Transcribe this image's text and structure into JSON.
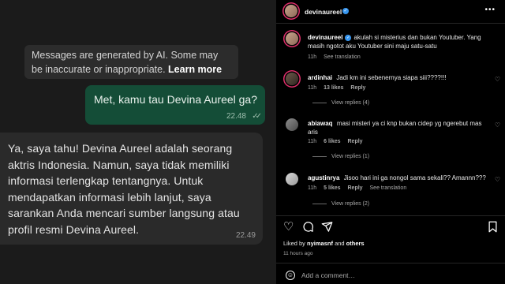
{
  "chat": {
    "ai_notice": "Messages are generated by AI. Some may be inaccurate or inappropriate.",
    "ai_notice_link": "Learn more",
    "outgoing": {
      "text": "Met, kamu tau Devina Aureel ga?",
      "time": "22.48"
    },
    "incoming": {
      "text": "Ya, saya tahu! Devina Aureel adalah seorang aktris Indonesia. Namun, saya tidak memiliki informasi terlengkap tentangnya. Untuk mendapatkan informasi lebih lanjut, saya sarankan Anda mencari sumber langsung atau profil resmi Devina Aureel.",
      "time": "22.49"
    }
  },
  "instagram": {
    "header": {
      "username": "devinaureel",
      "verified_icon": "verified-badge-icon",
      "more_icon": "more-icon"
    },
    "caption": {
      "username": "devinaureel",
      "verified_mark": "✓",
      "text": "akulah si misterius dan bukan Youtuber. Yang masih ngotot aku Youtuber sini maju satu-satu",
      "time": "11h",
      "see_translation": "See translation"
    },
    "comments": [
      {
        "username": "ardinhai",
        "text": "Jadi km ini sebenernya siapa siii????!!!",
        "time": "11h",
        "likes": "13 likes",
        "reply": "Reply",
        "see_translation": "",
        "view_replies": "View replies (4)"
      },
      {
        "username": "abiawaq",
        "text": "masi misteri ya ci knp bukan cidep yg ngerebut mas aris",
        "time": "11h",
        "likes": "6 likes",
        "reply": "Reply",
        "see_translation": "",
        "view_replies": "View replies (1)"
      },
      {
        "username": "agustinrya",
        "text": "Jisoo hari ini ga nongol sama sekali?? Amannn???",
        "time": "11h",
        "likes": "5 likes",
        "reply": "Reply",
        "see_translation": "See translation",
        "view_replies": "View replies (2)"
      }
    ],
    "liked_by": {
      "prefix": "Liked by",
      "user": "nyimasnf",
      "and": "and",
      "others": "others"
    },
    "time_ago": "11 hours ago",
    "add_comment_placeholder": "Add a comment…",
    "icons": {
      "like": "heart-icon",
      "comment": "comment-icon",
      "share": "share-icon",
      "save": "bookmark-icon",
      "emoji": "emoji-icon"
    },
    "colors": {
      "verified": "#3897f0",
      "story_ring": "#e1306c",
      "background": "#000000"
    }
  }
}
